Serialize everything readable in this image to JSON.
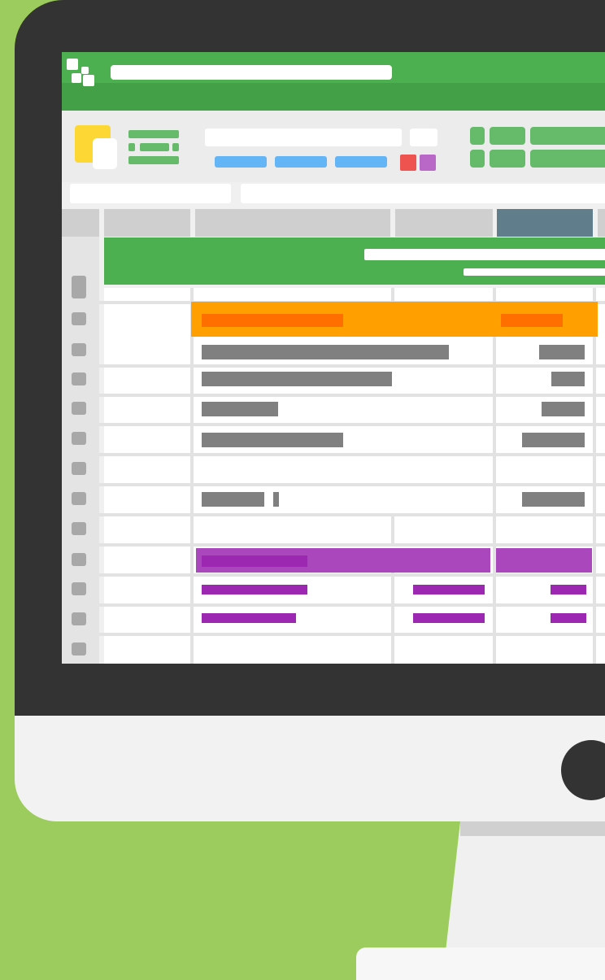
{
  "colors": {
    "background": "#9ccc5d",
    "bezel": "#333333",
    "brand_green": "#4caf50",
    "header_orange": "#ffa000",
    "header_orange_dark": "#ff6f00",
    "purple": "#ab47bc",
    "purple_dark": "#9c27b0",
    "gray_bar": "#808080",
    "selected_column": "#607d8b"
  },
  "icons": {
    "app": "grid-logo-icon",
    "paste": "paste-icon",
    "format": "list-format-icon",
    "power": "power-button-icon"
  },
  "window": {
    "title": ""
  },
  "ribbon": {
    "font_box": "",
    "size_box": ""
  },
  "formula_bar": {
    "name_box": "",
    "formula": ""
  },
  "sheet": {
    "banner_title": "",
    "banner_subtitle": "",
    "orange_header": [
      "",
      ""
    ],
    "gray_rows": [
      {
        "label": "",
        "value": ""
      },
      {
        "label": "",
        "value": ""
      },
      {
        "label": "",
        "value": ""
      },
      {
        "label": "",
        "value": ""
      },
      {
        "label": "",
        "value": ""
      }
    ],
    "purple_header": [
      "",
      ""
    ],
    "purple_rows": [
      {
        "label": "",
        "mid": "",
        "value": ""
      },
      {
        "label": "",
        "mid": "",
        "value": ""
      }
    ]
  }
}
